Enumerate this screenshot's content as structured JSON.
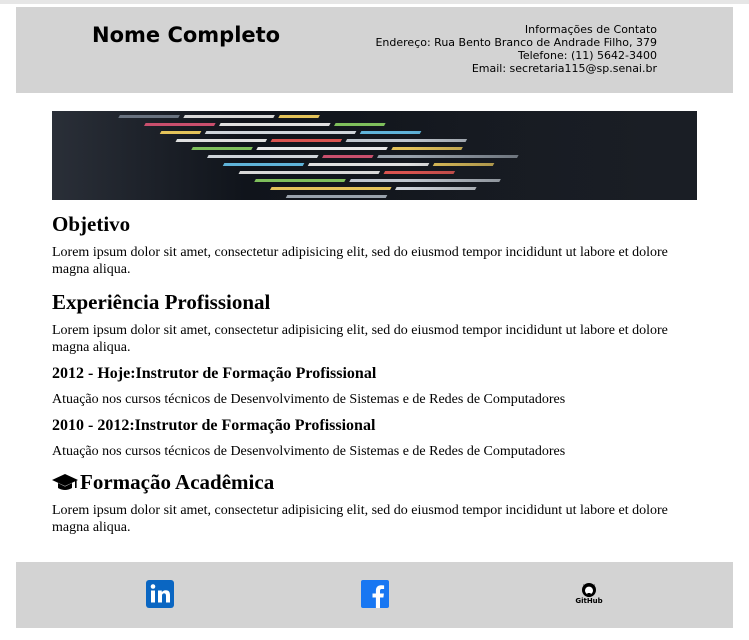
{
  "header": {
    "name": "Nome Completo",
    "contact_title": "Informações de Contato",
    "address": "Endereço: Rua Bento Branco de Andrade Filho, 379",
    "phone": "Telefone: (11) 5642-3400",
    "email": "Email: secretaria115@sp.senai.br"
  },
  "sections": {
    "objetivo": {
      "title": "Objetivo",
      "text": "Lorem ipsum dolor sit amet, consectetur adipisicing elit, sed do eiusmod tempor incididunt ut labore et dolore magna aliqua."
    },
    "experiencia": {
      "title": "Experiência Profissional",
      "text": "Lorem ipsum dolor sit amet, consectetur adipisicing elit, sed do eiusmod tempor incididunt ut labore et dolore magna aliqua.",
      "jobs": [
        {
          "title": "2012 - Hoje:Instrutor de Formação Profissional",
          "desc": "Atuação nos cursos técnicos de Desenvolvimento de Sistemas e de Redes de Computadores"
        },
        {
          "title": "2010 - 2012:Instrutor de Formação Profissional",
          "desc": "Atuação nos cursos técnicos de Desenvolvimento de Sistemas e de Redes de Computadores"
        }
      ]
    },
    "formacao": {
      "title": "Formação Acadêmica",
      "text": "Lorem ipsum dolor sit amet, consectetur adipisicing elit, sed do eiusmod tempor incididunt ut labore et dolore magna aliqua."
    }
  },
  "footer": {
    "github_label": "GitHub"
  },
  "colors": {
    "header_bg": "#d3d3d3",
    "linkedin": "#0a66c2",
    "facebook": "#1877f2"
  },
  "icons": [
    "graduation-cap-icon",
    "linkedin-icon",
    "facebook-icon",
    "github-icon"
  ]
}
